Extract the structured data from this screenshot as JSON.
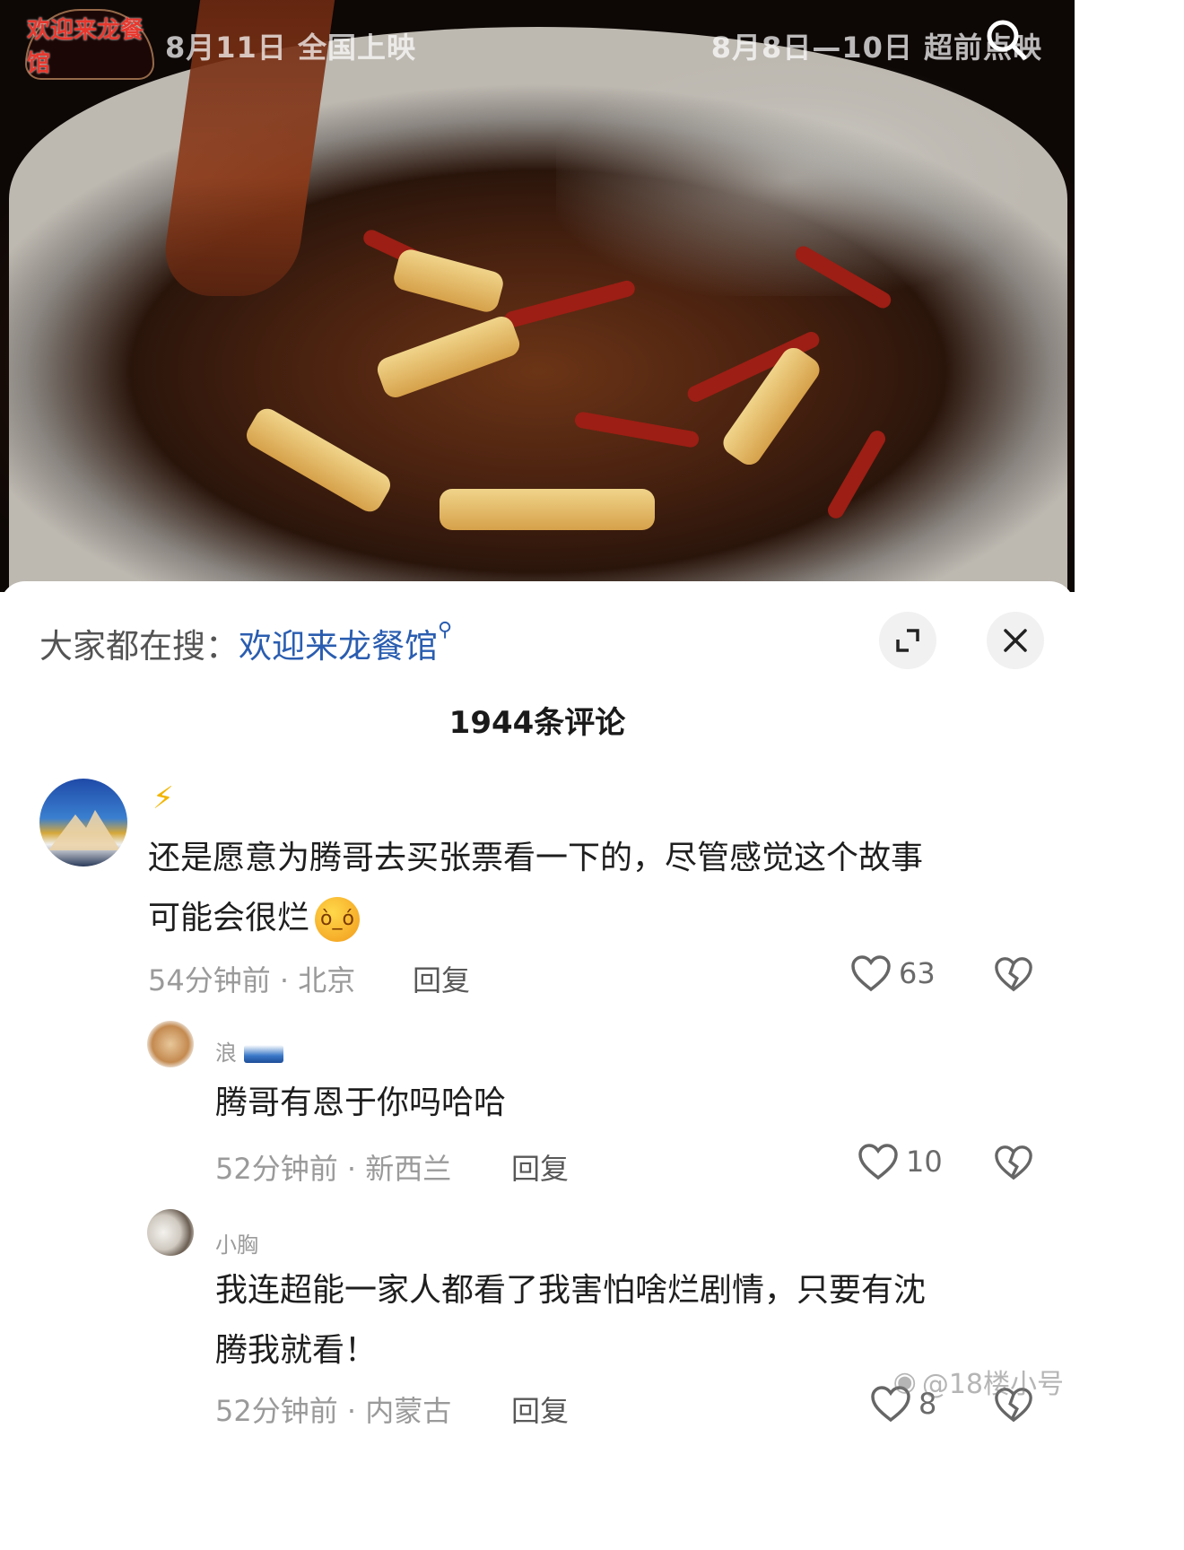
{
  "video": {
    "logo_text": "欢迎来龙餐馆",
    "release_left": "8月11日 全国上映",
    "release_right": "8月8日—10日 超前点映",
    "search_icon": "search-icon"
  },
  "sheet": {
    "search_prompt_label": "大家都在搜：",
    "search_term": "欢迎来龙餐馆",
    "search_term_icon": "magnifier-icon",
    "expand_icon": "expand-icon",
    "close_icon": "close-icon",
    "comment_count": "1944条评论"
  },
  "comments": [
    {
      "username": "",
      "text_line1": "还是愿意为腾哥去买张票看一下的，尽管感觉这个故事",
      "text_line2": "可能会很烂",
      "time_location": "54分钟前 · 北京",
      "reply_label": "回复",
      "likes": "63"
    },
    {
      "username": "浪",
      "text_line1": "腾哥有恩于你吗哈哈",
      "time_location": "52分钟前 · 新西兰",
      "reply_label": "回复",
      "likes": "10"
    },
    {
      "username": "小胸",
      "text_line1": "我连超能一家人都看了我害怕啥烂剧情，只要有沈",
      "text_line2": "腾我就看！",
      "time_location": "52分钟前 · 内蒙古",
      "reply_label": "回复",
      "likes": "8"
    }
  ],
  "watermark": "@18楼小号"
}
